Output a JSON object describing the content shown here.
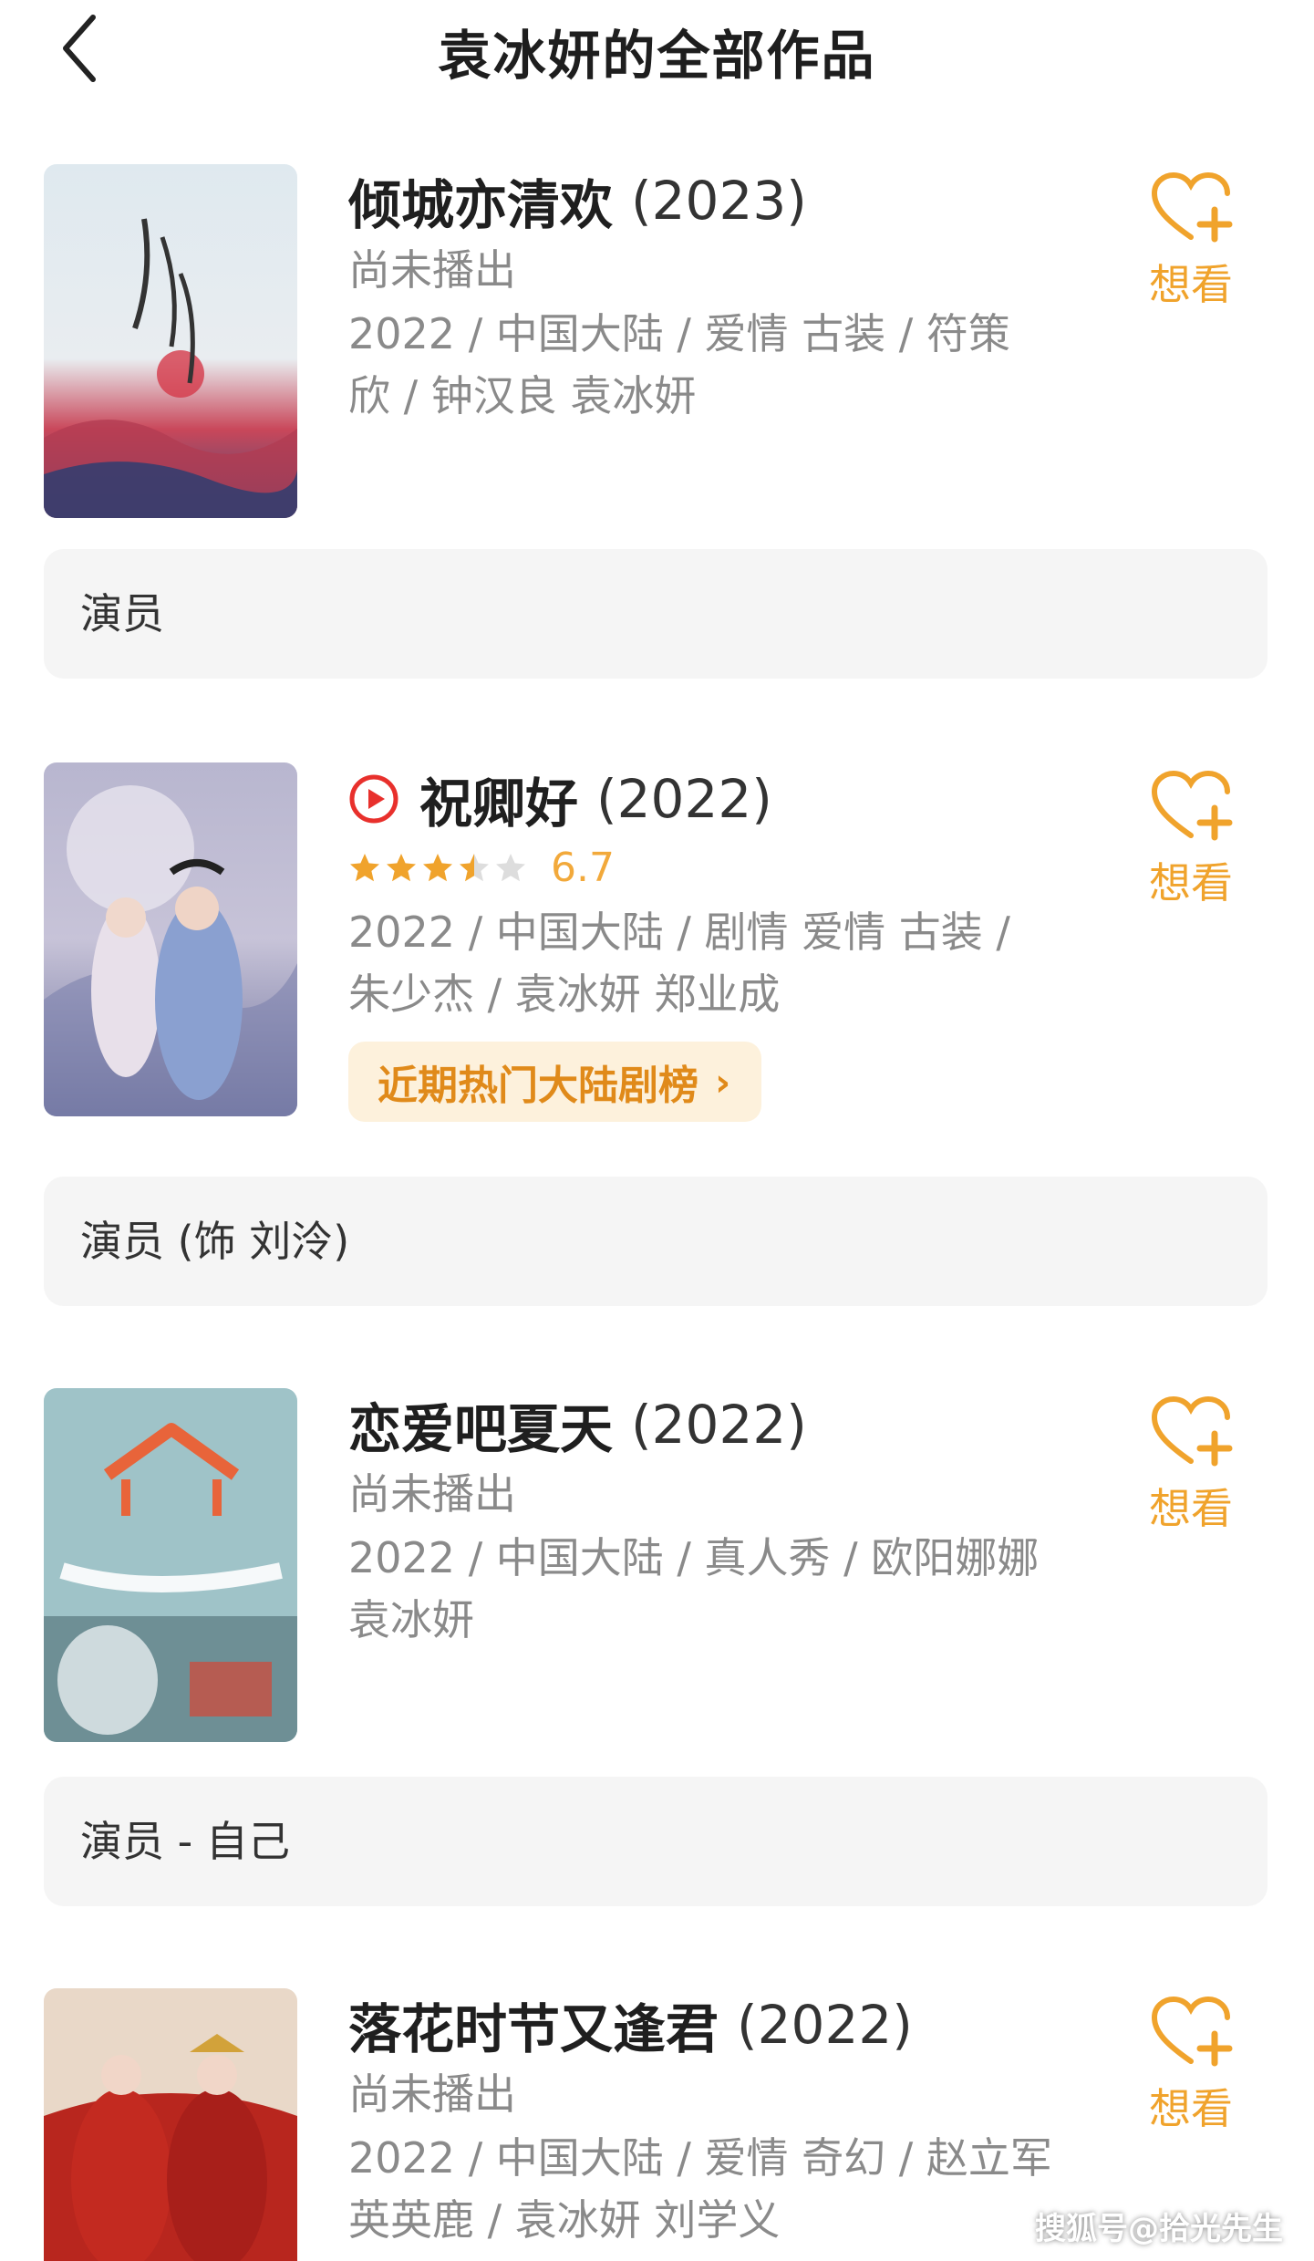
{
  "header": {
    "back_icon": "chevron-left-icon",
    "title": "袁冰妍的全部作品"
  },
  "colors": {
    "accent": "#f0a32c",
    "rank_text": "#e08a1a",
    "rank_bg": "#fdf1dc",
    "play_red": "#e8302c",
    "meta_gray": "#8a8a8a",
    "role_bg": "#f5f5f5"
  },
  "works": [
    {
      "title": "倾城亦清欢",
      "year": "(2023)",
      "status": "尚未播出",
      "meta_line1": "2022 / 中国大陆 / 爱情 古装 / 符策",
      "meta_line2": "欣 / 钟汉良 袁冰妍",
      "want_label": "想看",
      "want_icon": "heart-plus-icon",
      "role": "演员"
    },
    {
      "title": "祝卿好",
      "year": "(2022)",
      "play_icon": "play-circle-icon",
      "rating": 3.5,
      "rating_max": 5,
      "score": "6.7",
      "meta_line1": "2022 / 中国大陆 / 剧情 爱情 古装 /",
      "meta_line2": "朱少杰 / 袁冰妍 郑业成",
      "rank_badge": "近期热门大陆剧榜",
      "want_label": "想看",
      "want_icon": "heart-plus-icon",
      "role": "演员 (饰 刘泠)"
    },
    {
      "title": "恋爱吧夏天",
      "year": "(2022)",
      "status": "尚未播出",
      "meta_line1": "2022 / 中国大陆 / 真人秀 / 欧阳娜娜",
      "meta_line2": "袁冰妍",
      "want_label": "想看",
      "want_icon": "heart-plus-icon",
      "role": "演员 - 自己"
    },
    {
      "title": "落花时节又逢君",
      "year": "(2022)",
      "status": "尚未播出",
      "meta_line1": "2022 / 中国大陆 / 爱情 奇幻 / 赵立军",
      "meta_line2": "英英鹿 / 袁冰妍 刘学义",
      "want_label": "想看",
      "want_icon": "heart-plus-icon"
    }
  ],
  "watermark": "搜狐号@拾光先生"
}
